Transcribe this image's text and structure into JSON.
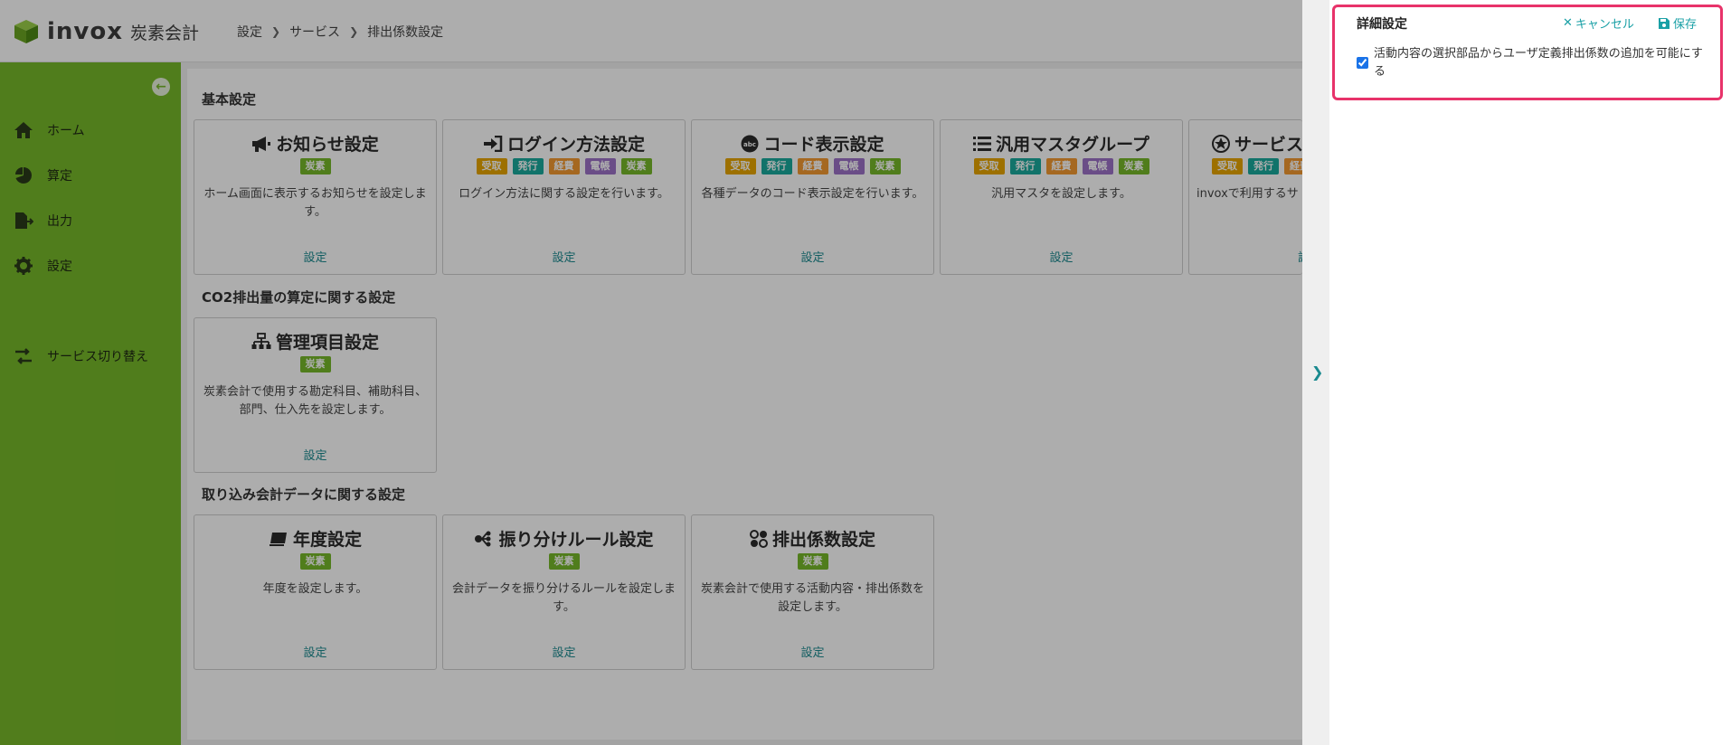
{
  "app": {
    "logo_text": "invox",
    "logo_sub": "炭素会計"
  },
  "breadcrumb": [
    "設定",
    "サービス",
    "排出係数設定"
  ],
  "sidebar": {
    "items": [
      {
        "label": "ホーム",
        "icon": "home-icon"
      },
      {
        "label": "算定",
        "icon": "pie-chart-icon"
      },
      {
        "label": "出力",
        "icon": "file-export-icon"
      },
      {
        "label": "設定",
        "icon": "gear-icon"
      },
      {
        "label": "サービス切り替え",
        "icon": "switch-icon"
      }
    ]
  },
  "tag_labels": {
    "carbon": "炭素",
    "receive": "受取",
    "issue": "発行",
    "expense": "経費",
    "ebook": "電帳"
  },
  "sections": [
    {
      "title": "基本設定",
      "cards": [
        {
          "title": "お知らせ設定",
          "icon": "megaphone-icon",
          "desc": "ホーム画面に表示するお知らせを設定します。",
          "link": "設定"
        },
        {
          "title": "ログイン方法設定",
          "icon": "sign-in-icon",
          "desc": "ログイン方法に関する設定を行います。",
          "link": "設定"
        },
        {
          "title": "コード表示設定",
          "icon": "abc-icon",
          "desc": "各種データのコード表示設定を行います。",
          "link": "設定"
        },
        {
          "title": "汎用マスタグループ",
          "icon": "list-icon",
          "desc": "汎用マスタを設定します。",
          "link": "設定"
        },
        {
          "title": "サービス",
          "icon": "star-icon",
          "desc": "invoxで利用するサ を行い",
          "link": "設"
        }
      ]
    },
    {
      "title": "CO2排出量の算定に関する設定",
      "cards": [
        {
          "title": "管理項目設定",
          "icon": "sitemap-icon",
          "desc": "炭素会計で使用する勘定科目、補助科目、部門、仕入先を設定します。",
          "link": "設定"
        }
      ]
    },
    {
      "title": "取り込み会計データに関する設定",
      "cards": [
        {
          "title": "年度設定",
          "icon": "calendar-stack-icon",
          "desc": "年度を設定します。",
          "link": "設定"
        },
        {
          "title": "振り分けルール設定",
          "icon": "sort-rules-icon",
          "desc": "会計データを振り分けるルールを設定します。",
          "link": "設定"
        },
        {
          "title": "排出係数設定",
          "icon": "cluster-icon",
          "desc": "炭素会計で使用する活動内容・排出係数を設定します。",
          "link": "設定"
        }
      ]
    }
  ],
  "panel": {
    "title": "詳細設定",
    "cancel": "キャンセル",
    "save": "保存",
    "checkbox_label": "活動内容の選択部品からユーザ定義排出係数の追加を可能にする",
    "checkbox_checked": true
  },
  "colors": {
    "sidebar": "#77b82a",
    "highlight_border": "#e8336a",
    "link": "#1aa0a6"
  }
}
